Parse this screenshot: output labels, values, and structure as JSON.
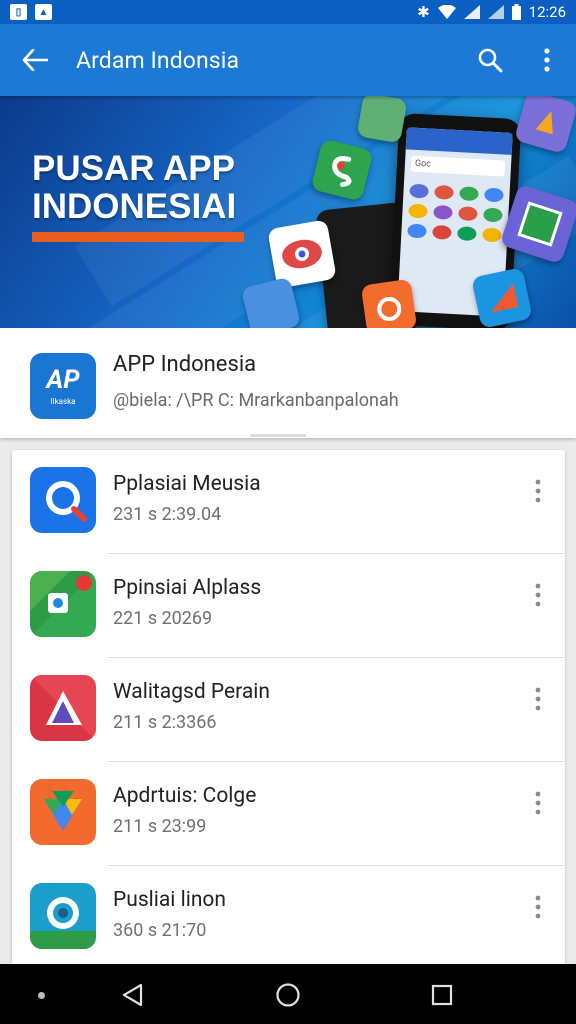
{
  "status_bar": {
    "time": "12:26"
  },
  "app_bar": {
    "title": "Ardam Indonsia",
    "back_icon": "arrow-back-icon",
    "search_icon": "search-icon",
    "more_icon": "more-vert-icon"
  },
  "banner": {
    "line1": "PUSAR APP",
    "line2": "INDONESIAI",
    "phone_search_text": "Goc"
  },
  "app_detail": {
    "name": "APP Indonesia",
    "subtitle": "@biela: /\\PR C: Mrarkanbanpalonah",
    "icon_text": "AP",
    "icon_subtext": "Ilkaska"
  },
  "apps": [
    {
      "name": "Pplasiai Meusia",
      "meta": "231 s 2:39.04",
      "icon": "search-app-icon",
      "color": "#1b73e8"
    },
    {
      "name": "Ppinsiai Alplass",
      "meta": "221 s 20269",
      "icon": "maps-app-icon",
      "color": "#2e9c47"
    },
    {
      "name": "Walitagsd Perain",
      "meta": "211 s 2:3366",
      "icon": "play-app-icon",
      "color": "#d93544"
    },
    {
      "name": "Apdrtuis: Colge",
      "meta": "211 s 23:99",
      "icon": "drive-app-icon",
      "color": "#f26a2e"
    },
    {
      "name": "Pusliai linon",
      "meta": "360 s 21:70",
      "icon": "camera-app-icon",
      "color": "#1b9ec9"
    }
  ],
  "nav_bar": {
    "back_icon": "nav-back-icon",
    "home_icon": "nav-home-icon",
    "recents_icon": "nav-recents-icon"
  }
}
